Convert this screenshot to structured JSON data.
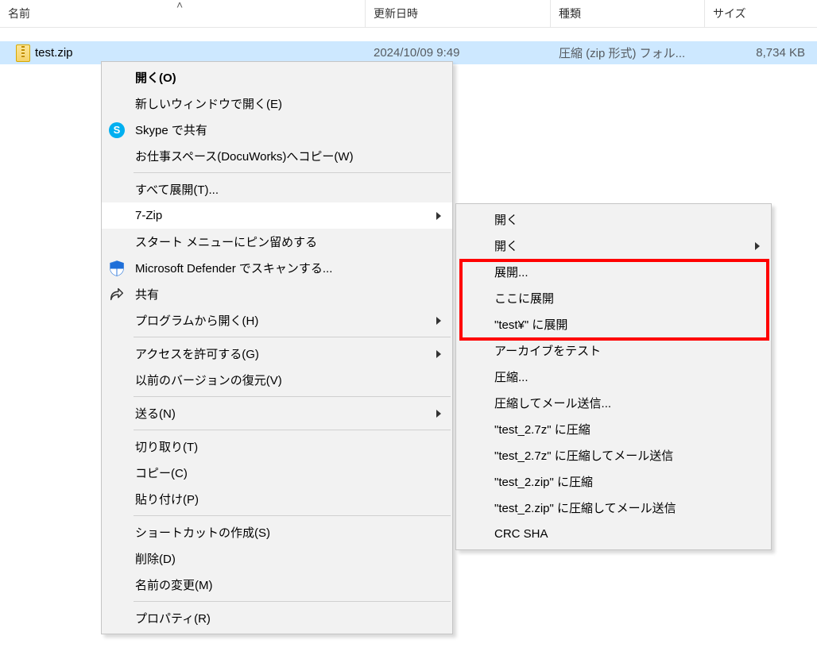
{
  "header": {
    "name": "名前",
    "date": "更新日時",
    "type": "種類",
    "size": "サイズ"
  },
  "file": {
    "name": "test.zip",
    "date": "2024/10/09 9:49",
    "type": "圧縮 (zip 形式) フォル...",
    "size": "8,734 KB"
  },
  "menu1": {
    "open": "開く(O)",
    "open_new_window": "新しいウィンドウで開く(E)",
    "skype_share": "Skype で共有",
    "docuworks_copy": "お仕事スペース(DocuWorks)へコピー(W)",
    "extract_all": "すべて展開(T)...",
    "seven_zip": "7-Zip",
    "pin_to_start": "スタート メニューにピン留めする",
    "defender_scan": "Microsoft Defender でスキャンする...",
    "share": "共有",
    "open_with": "プログラムから開く(H)",
    "give_access": "アクセスを許可する(G)",
    "restore_prev": "以前のバージョンの復元(V)",
    "send_to": "送る(N)",
    "cut": "切り取り(T)",
    "copy": "コピー(C)",
    "paste": "貼り付け(P)",
    "create_shortcut": "ショートカットの作成(S)",
    "delete": "削除(D)",
    "rename": "名前の変更(M)",
    "properties": "プロパティ(R)"
  },
  "menu2": {
    "open1": "開く",
    "open2": "開く",
    "extract": "展開...",
    "extract_here": "ここに展開",
    "extract_to_named": "\"test¥\" に展開",
    "test_archive": "アーカイブをテスト",
    "compress": "圧縮...",
    "compress_mail": "圧縮してメール送信...",
    "compress_7z": "\"test_2.7z\" に圧縮",
    "compress_7z_mail": "\"test_2.7z\" に圧縮してメール送信",
    "compress_zip": "\"test_2.zip\" に圧縮",
    "compress_zip_mail": "\"test_2.zip\" に圧縮してメール送信",
    "crc_sha": "CRC SHA"
  }
}
